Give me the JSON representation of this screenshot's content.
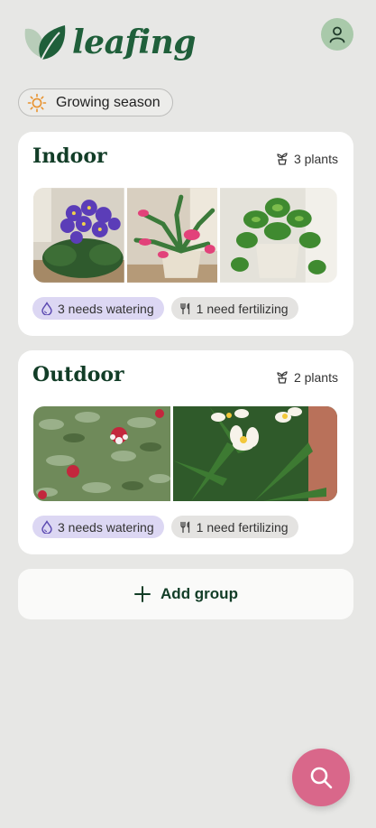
{
  "app": {
    "name": "leafing"
  },
  "season": {
    "label": "Growing season",
    "icon": "sun-icon"
  },
  "groups": [
    {
      "title": "Indoor",
      "plant_count": "3 plants",
      "photos": [
        "african-violet",
        "christmas-cactus",
        "pothos"
      ],
      "watering": "3 needs watering",
      "fertilizing": "1 need fertilizing"
    },
    {
      "title": "Outdoor",
      "plant_count": "2 plants",
      "photos": [
        "feijoa-flower-shrub",
        "plumeria"
      ],
      "watering": "3 needs watering",
      "fertilizing": "1 need fertilizing"
    }
  ],
  "add_group": {
    "label": "Add group"
  },
  "colors": {
    "brand_green": "#1f5f3a",
    "title_green": "#123d27",
    "water_chip": "#dcd7f3",
    "fert_chip": "#e4e3e1",
    "fab": "#d9678a"
  }
}
